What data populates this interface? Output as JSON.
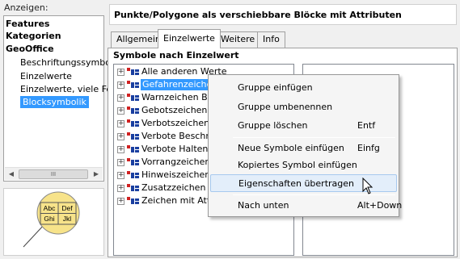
{
  "left": {
    "show_label": "Anzeigen:",
    "tree": [
      {
        "label": "Features",
        "style": "bold"
      },
      {
        "label": "Kategorien",
        "style": "bold"
      },
      {
        "label": "GeoOffice",
        "style": "bold"
      },
      {
        "label": "Beschriftungssymbol",
        "style": "sub"
      },
      {
        "label": "Einzelwerte",
        "style": "sub"
      },
      {
        "label": "Einzelwerte, viele Fe",
        "style": "sub"
      },
      {
        "label": "Blocksymbolik",
        "style": "selected"
      }
    ],
    "scroll_thumb": "III",
    "preview_cells": [
      "Abc",
      "Def",
      "Ghi",
      "Jkl"
    ],
    "preview_circle_color": "#f7e38a"
  },
  "right": {
    "title": "Punkte/Polygone als verschiebbare Blöcke mit Attributen",
    "tabs": [
      "Allgemein",
      "Einzelwerte",
      "Weitere",
      "Info"
    ],
    "active_tab": "Einzelwerte",
    "section_title": "Symbole nach Einzelwert",
    "rows": [
      {
        "label": "Alle anderen Werte",
        "selected": false
      },
      {
        "label": "Gefahrenzeichen",
        "selected": true
      },
      {
        "label": "Warnzeichen Bah",
        "selected": false
      },
      {
        "label": "Gebotszeichen",
        "selected": false
      },
      {
        "label": "Verbotszeichen",
        "selected": false
      },
      {
        "label": "Verbote Beschrän",
        "selected": false
      },
      {
        "label": "Verbote Halten un",
        "selected": false
      },
      {
        "label": "Vorrangzeichen",
        "selected": false
      },
      {
        "label": "Hinweiszeichen",
        "selected": false
      },
      {
        "label": "Zusatzzeichen",
        "selected": false
      },
      {
        "label": "Zeichen mit Attrib",
        "selected": false
      }
    ]
  },
  "context_menu": {
    "items": [
      {
        "label": "Gruppe einfügen",
        "shortcut": ""
      },
      {
        "label": "Gruppe umbenennen",
        "shortcut": ""
      },
      {
        "label": "Gruppe löschen",
        "shortcut": "Entf"
      },
      {
        "label": "Neue Symbole einfügen",
        "shortcut": "Einfg"
      },
      {
        "label": "Kopiertes Symbol einfügen",
        "shortcut": ""
      },
      {
        "label": "Eigenschaften übertragen",
        "shortcut": "",
        "hover": true
      },
      {
        "label": "Nach unten",
        "shortcut": "Alt+Down"
      }
    ]
  },
  "colors": {
    "selection": "#3399ff",
    "menu_hover": "#e3eefa",
    "icon_red": "#d02020",
    "icon_blue": "#1a3fa0"
  }
}
